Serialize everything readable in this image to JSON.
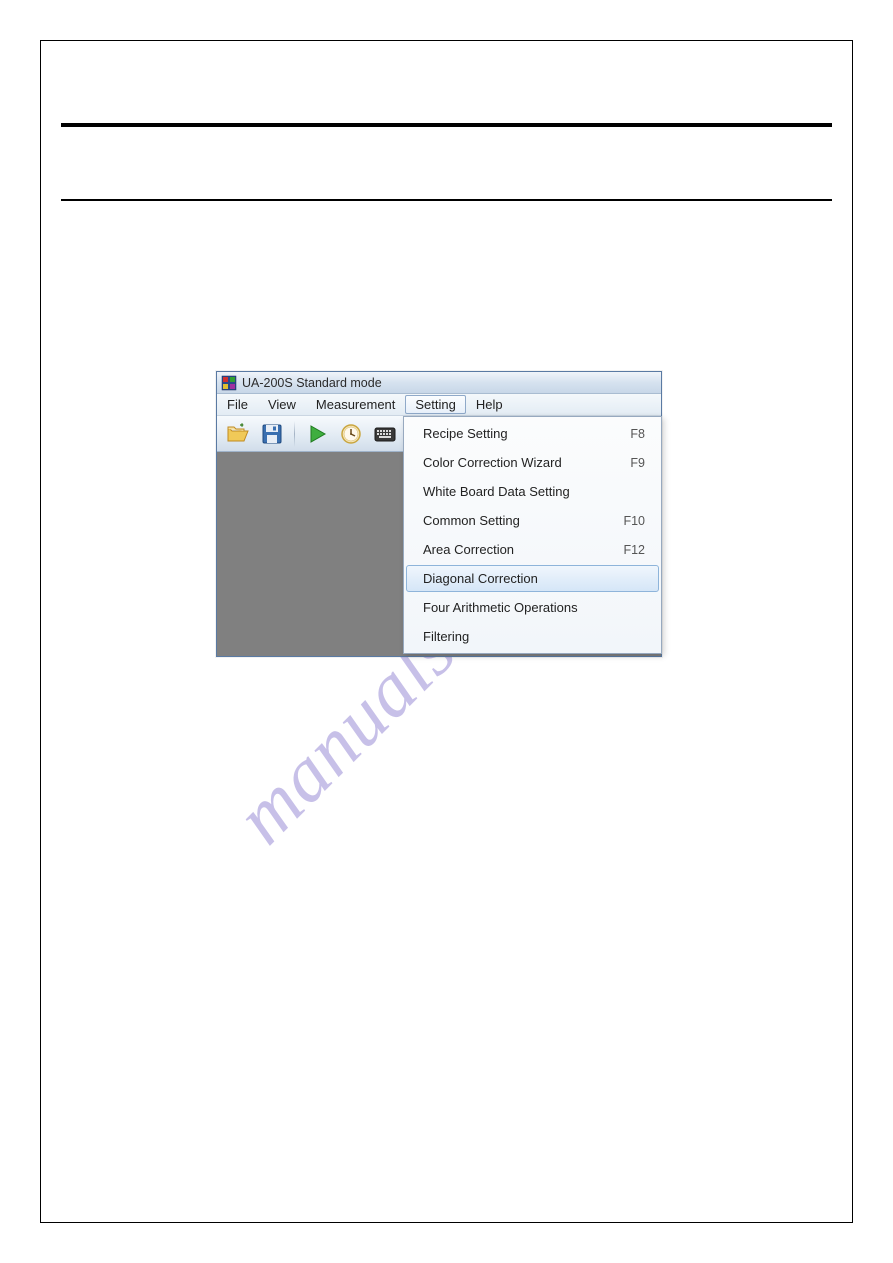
{
  "watermark": "manualshive.com",
  "window": {
    "title": "UA-200S Standard mode"
  },
  "menubar": {
    "items": [
      {
        "label": "File"
      },
      {
        "label": "View"
      },
      {
        "label": "Measurement"
      },
      {
        "label": "Setting",
        "active": true
      },
      {
        "label": "Help"
      }
    ]
  },
  "toolbar": {
    "icons": [
      "open-icon",
      "save-icon",
      "play-icon",
      "clock-icon",
      "keyboard-icon"
    ]
  },
  "dropdown": {
    "items": [
      {
        "label": "Recipe Setting",
        "shortcut": "F8"
      },
      {
        "label": "Color Correction Wizard",
        "shortcut": "F9"
      },
      {
        "label": "White Board Data Setting",
        "shortcut": ""
      },
      {
        "label": "Common Setting",
        "shortcut": "F10"
      },
      {
        "label": "Area Correction",
        "shortcut": "F12"
      },
      {
        "label": "Diagonal Correction",
        "shortcut": "",
        "highlighted": true
      },
      {
        "label": "Four Arithmetic Operations",
        "shortcut": ""
      },
      {
        "label": "Filtering",
        "shortcut": ""
      }
    ]
  }
}
